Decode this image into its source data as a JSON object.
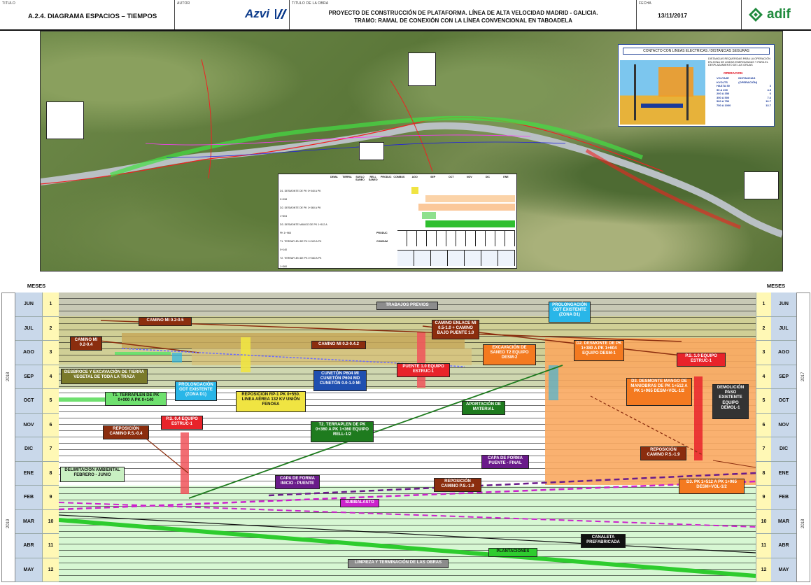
{
  "header": {
    "titulo_label": "TITULO",
    "titulo": "A.2.4. DIAGRAMA ESPACIOS – TIEMPOS",
    "autor_label": "AUTOR",
    "autor": "Azvi",
    "obra_label": "TITULO DE LA OBRA",
    "obra_line1": "PROYECTO DE CONSTRUCCIÓN DE PLATAFORMA. LÍNEA DE ALTA VELOCIDAD MADRID - GALICIA.",
    "obra_line2": "TRAMO: RAMAL DE CONEXIÓN CON LA LÍNEA CONVENCIONAL EN TABOADELA",
    "fecha_label": "FECHA",
    "fecha": "13/11/2017",
    "logo": "adif"
  },
  "map": {
    "safety_title": "CONTACTO CON LINEAS ELECTRICAS / DISTANCIAS SEGURAS",
    "safety_caption": "DISTANCIAS REQUERIDAS PARA LA OPERACIÓN EN ZONA DE LINEAS ENERGIZADAS Y PARA EL DESPLAZAMIENTO DE LAS GRUAS",
    "safety_table_title": "OPERACION",
    "safety_headers": [
      "VOLTAJE KVOLTS",
      "DISTANCIAS (OPERACIÓN)"
    ],
    "safety_rows": [
      [
        "HASTA 50",
        "3"
      ],
      [
        "50 A 200",
        "4.5"
      ],
      [
        "200 A 350",
        "6"
      ],
      [
        "350 A 500",
        "7.6"
      ],
      [
        "500 A 750",
        "10.7"
      ],
      [
        "750 A 1000",
        "13.7"
      ]
    ],
    "table_headers": [
      "DEMA",
      "TIERRA",
      "SUELO SANEO",
      "RELL SANEO",
      "PRODUC",
      "COMBUS",
      "AGO",
      "SEP",
      "OCT",
      "NOV",
      "DIC",
      "ENE"
    ],
    "table_rows": [
      "D1. DESMONTE DE PK 0+040 A PK 0+098",
      "D2. DESMONTE DE PK 1+360 A PK 1+604",
      "D3. DESMONTE MANGO DE PK 1+512 A PK 1+965",
      "T1. TERRAPLEN DE PK 0+000 A PK 0+140",
      "T2. TERRAPLEN DE PK 0+360 A PK 1+360"
    ],
    "table_footer": [
      "PRODUC",
      "CONSUM"
    ]
  },
  "gantt": {
    "meses_label": "MESES",
    "months": [
      {
        "name": "JUN",
        "num": "1"
      },
      {
        "name": "JUL",
        "num": "2"
      },
      {
        "name": "AGO",
        "num": "3"
      },
      {
        "name": "SEP",
        "num": "4"
      },
      {
        "name": "OCT",
        "num": "5"
      },
      {
        "name": "NOV",
        "num": "6"
      },
      {
        "name": "DIC",
        "num": "7"
      },
      {
        "name": "ENE",
        "num": "8"
      },
      {
        "name": "FEB",
        "num": "9"
      },
      {
        "name": "MAR",
        "num": "10"
      },
      {
        "name": "ABR",
        "num": "11"
      },
      {
        "name": "MAY",
        "num": "12"
      }
    ],
    "year_left_top": "2018",
    "year_left_bottom": "2019",
    "year_right_top": "2017",
    "year_right_bottom": "2018",
    "labels": {
      "trabajos": "TRABAJOS PREVIOS",
      "camino_mi_0205": "CAMINO MI 0.2-0.5",
      "camino_mi_0204": "CAMINO MI 0.2-0.4",
      "camino_mi_0242": "CAMINO MI 0.2-0.4.2",
      "camino_enlace": "CAMINO ENLACE MI 0.5-1.0 + CAMINO BAJO PUENTE 1.0",
      "prolong_d1_right": "PROLONGACIÓN ODT EXISTENTE (ZONA D1)",
      "d2_desmonte": "D2. DESMONTE DE PK 1+380 A PK 1+604 EQUIPO DESM-1",
      "excavacion": "EXCAVACIÓN DE SANEO T2 EQUIPO DESM-2",
      "ps10": "P.S. 1.0 EQUIPO ESTRUC-1",
      "desbroce": "DESBROCE Y EXCAVACIÓN DE TIERRA VEGETAL DE TODA LA TRAZA",
      "prolong_d1_left": "PROLONGACIÓN ODT EXISTENTE (ZONA D1)",
      "reposicion_rp1": "REPOSICIÓN RP-1 PK 0+550. LINEA AÉREA 132 KV UNIÓN FENOSA",
      "cuneton": "CUNETÓN P604 MI CUNETÓN P604 MD CUNETÓN 0.0-1.0 MI",
      "puente10": "PUENTE 1.0 EQUIPO ESTRUC-1",
      "d3_desmonte": "D3. DESMONTE MANGO DE MANIOBRAS DE PK 1+512 A PK 1+965 DESM+VOL-1/2",
      "demolicion": "DEMOLICIÓN PASO EXISTENTE EQUIPO DEMOL-1",
      "t1_terraplen": "T1. TERRAPLEN DE PK 0+000 A PK 0+140",
      "aportacion": "APORTACIÓN DE MATERIAL",
      "reposicion_p04": "REPOSICIÓN CAMINO P.S.-0.4",
      "ps04": "P.S. 0.4 EQUIPO ESTRUC-1",
      "t2_terraplen": "T2. TERRAPLEN DE PK 0+360 A PK 1+360 EQUIPO RELL-1/2",
      "reposicion_p19_right": "REPOSICIÓN CAMINO P.S.-1.9",
      "capa_puente": "CAPA DE FORMA PUENTE - FINAL",
      "delimitacion": "DELIMITACIÓN AMBIENTAL FEBRERO - JUNIO",
      "capa_inicio": "CAPA DE FORMA INICIO - PUENTE",
      "reposicion_p19_mid": "REPOSICIÓN CAMINO P.S.-1.9",
      "d3_pk": "D3. PK 1+512 A PK 1+965 DESM+VOL-1/2",
      "subbalasto": "SUBBALASTO",
      "canaleta": "CANALETA PREFABRICADA",
      "plantaciones": "PLANTACIONES",
      "limpieza": "LIMPIEZA Y TERMINACIÓN DE LAS OBRAS"
    }
  },
  "colors": {
    "brown": "#8b2d0e",
    "orange": "#f47a20",
    "green_dark": "#1e7b1e",
    "green_bright": "#2ecc2e",
    "magenta": "#cc22cc",
    "purple": "#6a1b8a",
    "cyan": "#29b6e8",
    "yellow": "#f0e442",
    "red": "#e8232a",
    "olive": "#7a7a2a",
    "gray": "#8c8c8c"
  }
}
